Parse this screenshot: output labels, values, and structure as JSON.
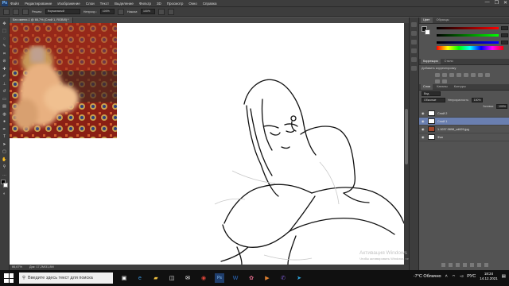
{
  "app": {
    "logo": "Ps",
    "menu": [
      "Файл",
      "Редактирование",
      "Изображение",
      "Слои",
      "Текст",
      "Выделение",
      "Фильтр",
      "3D",
      "Просмотр",
      "Окно",
      "Справка"
    ],
    "window_controls": [
      "—",
      "❐",
      "✕"
    ]
  },
  "options_bar": {
    "mode_label": "Режим:",
    "mode_value": "Нормальный",
    "opacity_label": "Непрозр.:",
    "opacity_value": "100%",
    "flow_label": "Нажим:",
    "flow_value": "100%"
  },
  "document": {
    "tab_title": "Без имени-1 @ 66,7% (Слой 1, RGB/8) *",
    "zoom": "66,67%",
    "doc_info": "Док: 17,2M/31,8M"
  },
  "panels": {
    "color_tabs": [
      "Цвет",
      "Образцы"
    ],
    "corrections_tabs": [
      "Коррекция",
      "Стили"
    ],
    "corrections_title": "Добавить корректировку",
    "layers_tabs": [
      "Слои",
      "Каналы",
      "Контуры"
    ],
    "kind_value": "Вид",
    "blend_value": "Обычные",
    "opacity_label": "Непрозрачность:",
    "opacity_value": "100%",
    "fill_label": "Заливка:",
    "fill_value": "100%",
    "layers": [
      {
        "name": "Слой 2",
        "selected": false
      },
      {
        "name": "Слой 1",
        "selected": true
      },
      {
        "name": "1.1037.9898_cd629.jpg",
        "selected": false
      },
      {
        "name": "Фон",
        "selected": false
      }
    ]
  },
  "activation": {
    "title": "Активация Windows",
    "subtitle": "Чтобы активировать Windows, перейдите в раздел \"Параметры\"."
  },
  "taskbar": {
    "search_placeholder": "Введите здесь текст для поиска",
    "apps": [
      "search-icon",
      "task-view-icon",
      "edge-icon",
      "explorer-icon",
      "store-icon",
      "mail-icon",
      "chrome-icon",
      "photoshop-icon",
      "word-icon",
      "paint-icon",
      "media-icon",
      "viber-icon",
      "telegram-icon"
    ],
    "weather": "-7°C Облачно",
    "time": "18:24",
    "date": "14.12.2021",
    "lang": "РУС"
  },
  "colors": {
    "app_bg": "#535353",
    "panel": "#3d3d3d",
    "selected_layer": "#6a7fb0",
    "taskbar": "#101010"
  }
}
